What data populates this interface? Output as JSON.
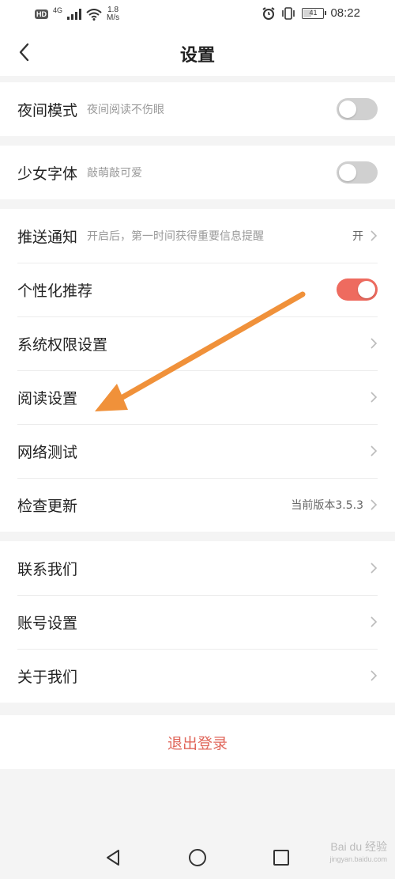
{
  "status_bar": {
    "hd_badge": "HD",
    "signal_type": "4G",
    "net_speed_value": "1.8",
    "net_speed_unit": "M/s",
    "battery_level": "41",
    "time": "08:22"
  },
  "header": {
    "title": "设置"
  },
  "sections": {
    "s1": {
      "title": "夜间模式",
      "subtitle": "夜间阅读不伤眼",
      "toggle_on": false
    },
    "s2": {
      "title": "少女字体",
      "subtitle": "敲萌敲可爱",
      "toggle_on": false
    },
    "s3": {
      "push": {
        "title": "推送通知",
        "subtitle": "开启后，第一时间获得重要信息提醒",
        "value": "开"
      },
      "personalize": {
        "title": "个性化推荐",
        "toggle_on": true
      },
      "permissions": {
        "title": "系统权限设置"
      },
      "reading": {
        "title": "阅读设置"
      },
      "network": {
        "title": "网络测试"
      },
      "update": {
        "title": "检查更新",
        "value": "当前版本3.5.3"
      }
    },
    "s4": {
      "contact": {
        "title": "联系我们"
      },
      "account": {
        "title": "账号设置"
      },
      "about": {
        "title": "关于我们"
      }
    }
  },
  "logout": {
    "label": "退出登录"
  },
  "watermark": {
    "text": "Bai du 经验",
    "sub": "jingyan.baidu.com"
  },
  "colors": {
    "accent": "#ee6b5f",
    "logout": "#e0675b",
    "arrow": "#f0913a",
    "toggle_off": "#d0d0d0"
  },
  "icons": [
    "back-arrow-icon",
    "chevron-right-icon",
    "triangle-back-icon",
    "circle-home-icon",
    "square-recents-icon",
    "alarm-icon",
    "vibrate-icon",
    "wifi-icon",
    "signal-icon",
    "battery-icon"
  ]
}
